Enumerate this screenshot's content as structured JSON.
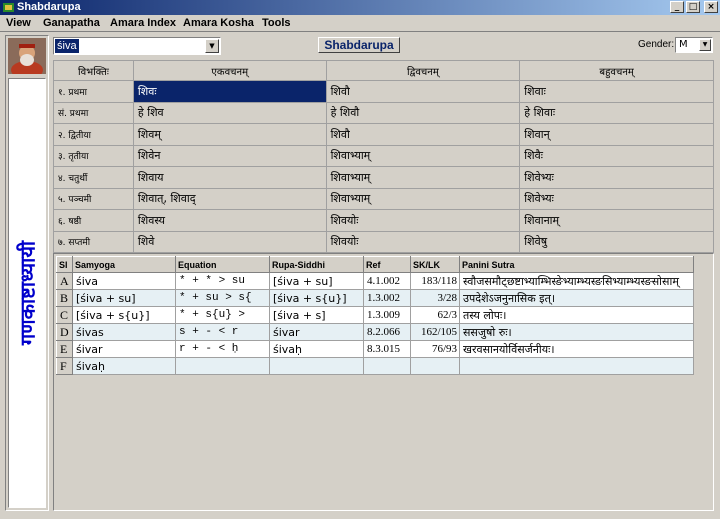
{
  "window": {
    "title": "Shabdarupa"
  },
  "menu": [
    "View",
    "Ganapatha",
    "Amara Index",
    "Amara Kosha",
    "Tools"
  ],
  "sidebar": {
    "vertical_text": "गणकाष्टाध्यायी"
  },
  "search": {
    "value": "śiva"
  },
  "shabdarupa_button": "Shabdarupa",
  "gender": {
    "label": "Gender:",
    "value": "M"
  },
  "declension": {
    "headers": [
      "विभक्तिः",
      "एकवचनम्",
      "द्विवचनम्",
      "बहुवचनम्"
    ],
    "rows": [
      {
        "case": "१. प्रथमा",
        "eka": "शिवः",
        "dvi": "शिवौ",
        "bahu": "शिवाः"
      },
      {
        "case": "सं. प्रथमा",
        "eka": "हे शिव",
        "dvi": "हे शिवौ",
        "bahu": "हे शिवाः"
      },
      {
        "case": "२. द्वितीया",
        "eka": "शिवम्",
        "dvi": "शिवौ",
        "bahu": "शिवान्"
      },
      {
        "case": "३. तृतीया",
        "eka": "शिवेन",
        "dvi": "शिवाभ्याम्",
        "bahu": "शिवैः"
      },
      {
        "case": "४. चतुर्थी",
        "eka": "शिवाय",
        "dvi": "शिवाभ्याम्",
        "bahu": "शिवेभ्यः"
      },
      {
        "case": "५. पञ्चमी",
        "eka": "शिवात्, शिवाद्",
        "dvi": "शिवाभ्याम्",
        "bahu": "शिवेभ्यः"
      },
      {
        "case": "६. षष्ठी",
        "eka": "शिवस्य",
        "dvi": "शिवयोः",
        "bahu": "शिवानाम्"
      },
      {
        "case": "७. सप्तमी",
        "eka": "शिवे",
        "dvi": "शिवयोः",
        "bahu": "शिवेषु"
      }
    ]
  },
  "derivation": {
    "headers": [
      "Sl",
      "Samyoga",
      "Equation",
      "Rupa-Siddhi",
      "Ref",
      "SK/LK",
      "Panini Sutra"
    ],
    "rows": [
      {
        "sl": "A",
        "samyoga": "śiva",
        "equation": "* + * > su",
        "rupa": "[śiva + su]",
        "ref": "4.1.002",
        "sk": "183/118",
        "sutra": "स्वौजसमौट्छष्टाभ्याम्भिस्ङेभ्याम्भ्यस्ङसिभ्याम्भ्यस्ङसोसाम्"
      },
      {
        "sl": "B",
        "samyoga": "[śiva + su]",
        "equation": "* + su  >  s{",
        "rupa": "[śiva + s{u}]",
        "ref": "1.3.002",
        "sk": "3/28",
        "sutra": "उपदेशेऽजनुनासिक इत्।"
      },
      {
        "sl": "C",
        "samyoga": "[śiva + s{u}]",
        "equation": "* + s{u}  >",
        "rupa": "[śiva + s]",
        "ref": "1.3.009",
        "sk": "62/3",
        "sutra": "तस्य लोपः।"
      },
      {
        "sl": "D",
        "samyoga": "śivas",
        "equation": "s + -  <  r",
        "rupa": "śivar",
        "ref": "8.2.066",
        "sk": "162/105",
        "sutra": "ससजुषो रुः।"
      },
      {
        "sl": "E",
        "samyoga": "śivar",
        "equation": "r + -  <  ḥ",
        "rupa": "śivaḥ",
        "ref": "8.3.015",
        "sk": "76/93",
        "sutra": "खरवसानयोर्विसर्जनीयः।"
      },
      {
        "sl": "F",
        "samyoga": "śivaḥ",
        "equation": "",
        "rupa": "",
        "ref": "",
        "sk": "",
        "sutra": ""
      }
    ]
  }
}
